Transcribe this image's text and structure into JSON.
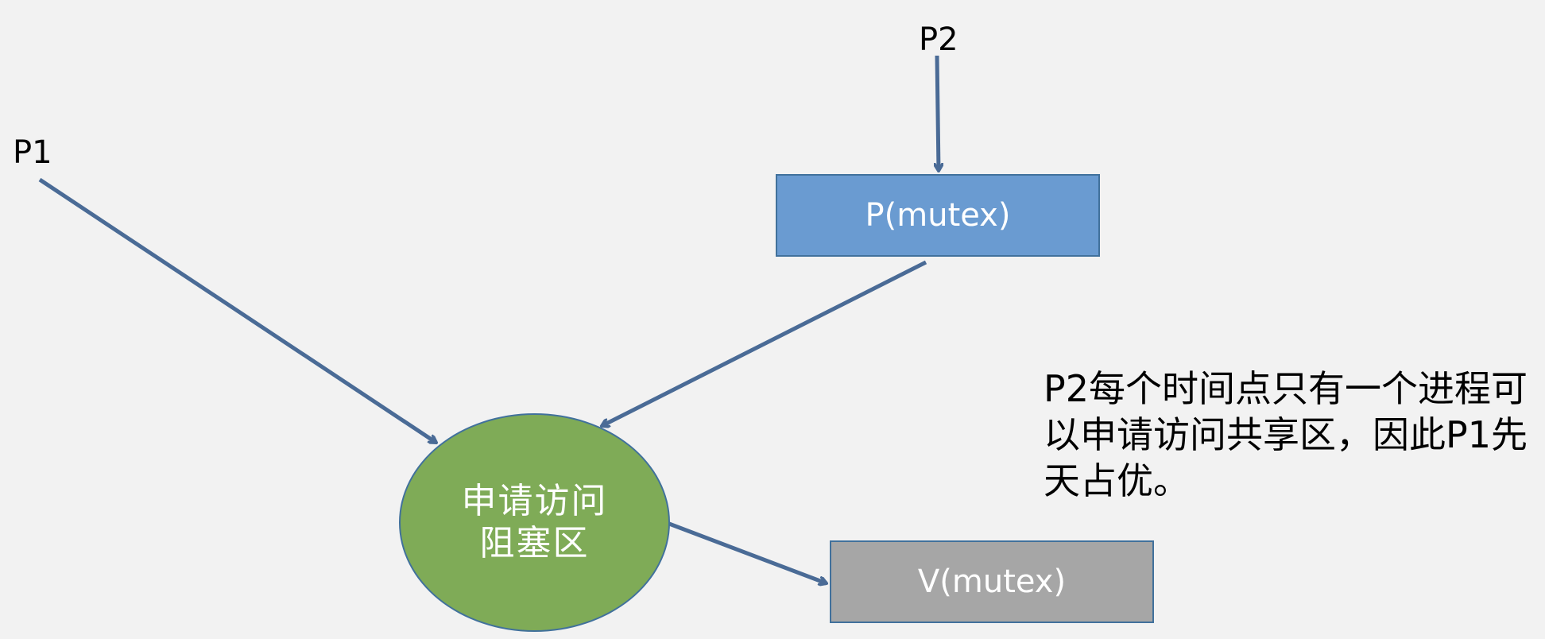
{
  "labels": {
    "p1": "P1",
    "p2": "P2"
  },
  "nodes": {
    "p_mutex": "P(mutex)",
    "v_mutex": "V(mutex)",
    "block_area_line1": "申请访问",
    "block_area_line2": "阻塞区"
  },
  "note": "P2每个时间点只有一个进程可以申请访问共享区，因此P1先天占优。",
  "colors": {
    "background": "#f2f2f2",
    "p_box": "#6a9bd1",
    "v_box": "#a6a6a6",
    "ellipse": "#7fab57",
    "arrow": "#4a6b96",
    "border": "#41719c"
  }
}
